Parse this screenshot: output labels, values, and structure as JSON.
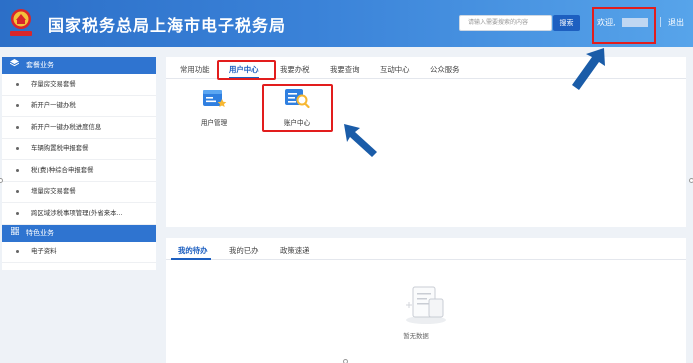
{
  "header": {
    "title": "国家税务总局上海市电子税务局",
    "search_placeholder": "请输入需要搜索的内容",
    "search_button": "搜索",
    "welcome": "欢迎,",
    "logout": "退出"
  },
  "sidebar": {
    "groups": [
      {
        "title": "套餐业务",
        "icon": "layers-icon",
        "items": [
          "存量房交易套餐",
          "新开户一键办税",
          "新开户一键办税进度信息",
          "车辆购置税申报套餐",
          "税(费)种综合申报套餐",
          "增量房交易套餐",
          "跨区域涉税事项管理(外省来本..."
        ]
      },
      {
        "title": "特色业务",
        "icon": "grid-icon",
        "items": [
          "电子资料"
        ]
      }
    ]
  },
  "main_tabs": {
    "items": [
      "常用功能",
      "用户中心",
      "我要办税",
      "我要查询",
      "互动中心",
      "公众服务"
    ],
    "active": "用户中心"
  },
  "functions": [
    {
      "label": "用户管理",
      "icon": "user-management-icon"
    },
    {
      "label": "账户中心",
      "icon": "account-center-icon"
    }
  ],
  "bottom_tabs": {
    "items": [
      "我的待办",
      "我的已办",
      "政策速递"
    ],
    "active": "我的待办"
  },
  "empty_state": {
    "text": "暂无数据",
    "icon": "empty-document-icon"
  },
  "colors": {
    "header_start": "#2c6fc8",
    "header_end": "#57a4ea",
    "accent": "#1d5fc0",
    "sidebar_group": "#2f74d0",
    "highlight_box": "#e21d1d",
    "arrow": "#1a5ca8"
  }
}
